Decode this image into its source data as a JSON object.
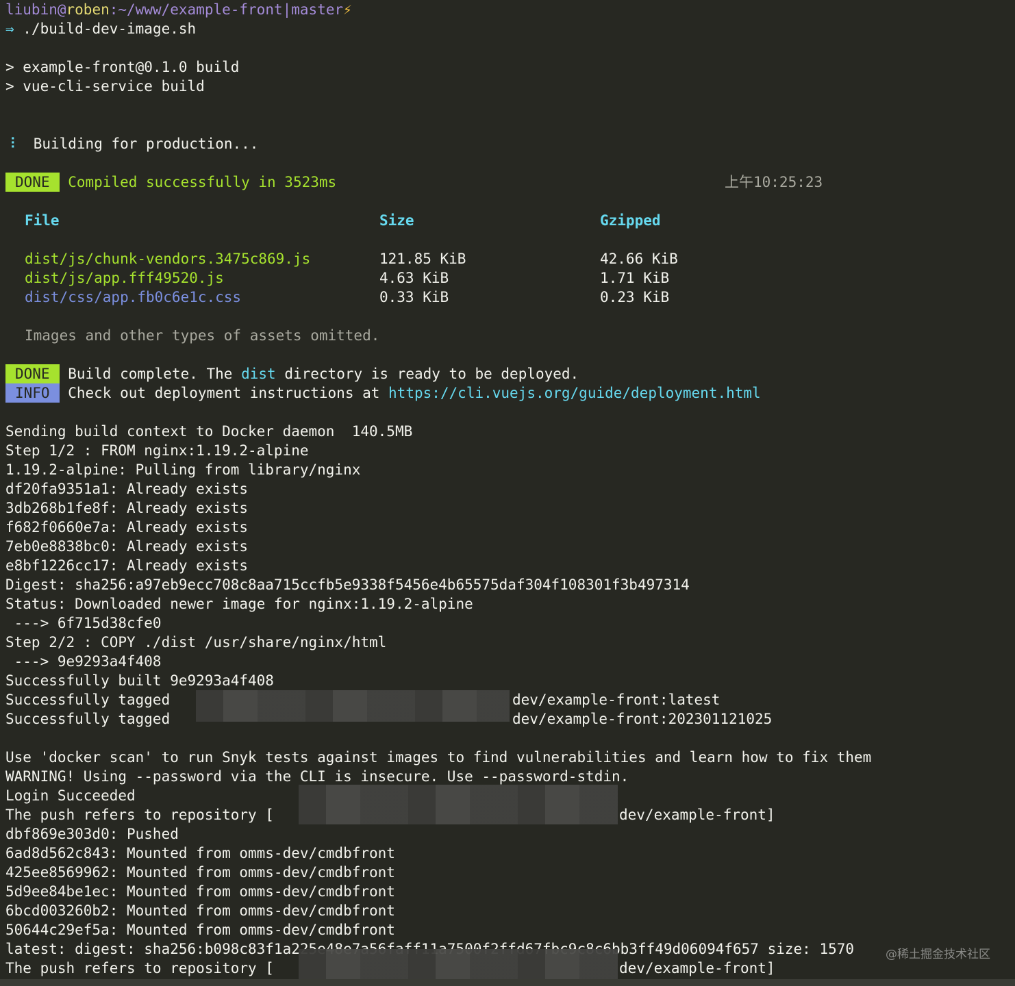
{
  "prompt": {
    "user": "liubin",
    "at": "@",
    "host": "roben",
    "colon": ":",
    "path": "~/www/example-front",
    "pipe": "|",
    "branch": "master",
    "bolt": "⚡",
    "arrow": "⇒",
    "command": " ./build-dev-image.sh"
  },
  "npm": {
    "line1": "> example-front@0.1.0 build",
    "line2": "> vue-cli-service build"
  },
  "building": {
    "spinner": "⠸",
    "text": "Building for production..."
  },
  "compiled": {
    "badge": "DONE",
    "text": "Compiled successfully in 3523ms",
    "time": "上午10:25:23"
  },
  "assets": {
    "headers": {
      "file": "File",
      "size": "Size",
      "gzipped": "Gzipped"
    },
    "rows": [
      {
        "file": "dist/js/chunk-vendors.3475c869.js",
        "size": "121.85 KiB",
        "gzipped": "42.66 KiB",
        "kind": "js"
      },
      {
        "file": "dist/js/app.fff49520.js",
        "size": "4.63 KiB",
        "gzipped": "1.71 KiB",
        "kind": "js"
      },
      {
        "file": "dist/css/app.fb0c6e1c.css",
        "size": "0.33 KiB",
        "gzipped": "0.23 KiB",
        "kind": "css"
      }
    ],
    "omitted": "Images and other types of assets omitted."
  },
  "build_done": {
    "badge": "DONE",
    "pre": "Build complete. The ",
    "dist": "dist",
    "post": " directory is ready to be deployed."
  },
  "build_info": {
    "badge": "INFO",
    "pre": "Check out deployment instructions at ",
    "url": "https://cli.vuejs.org/guide/deployment.html"
  },
  "docker_lines": [
    "Sending build context to Docker daemon  140.5MB",
    "Step 1/2 : FROM nginx:1.19.2-alpine",
    "1.19.2-alpine: Pulling from library/nginx",
    "df20fa9351a1: Already exists",
    "3db268b1fe8f: Already exists",
    "f682f0660e7a: Already exists",
    "7eb0e8838bc0: Already exists",
    "e8bf1226cc17: Already exists",
    "Digest: sha256:a97eb9ecc708c8aa715ccfb5e9338f5456e4b65575daf304f108301f3b497314",
    "Status: Downloaded newer image for nginx:1.19.2-alpine",
    " ---> 6f715d38cfe0",
    "Step 2/2 : COPY ./dist /usr/share/nginx/html",
    " ---> 9e9293a4f408",
    "Successfully built 9e9293a4f408"
  ],
  "tagged": {
    "prefix": "Successfully tagged ",
    "tag1": "dev/example-front:latest",
    "tag2": "dev/example-front:202301121025"
  },
  "push_lines": {
    "scan": "Use 'docker scan' to run Snyk tests against images to find vulnerabilities and learn how to fix them",
    "warning": "WARNING! Using --password via the CLI is insecure. Use --password-stdin.",
    "login": "Login Succeeded",
    "push_prefix": "The push refers to repository [",
    "push_suffix": "dev/example-front]",
    "layers": [
      "dbf869e303d0: Pushed",
      "6ad8d562c843: Mounted from omms-dev/cmdbfront",
      "425ee8569962: Mounted from omms-dev/cmdbfront",
      "5d9ee84be1ec: Mounted from omms-dev/cmdbfront",
      "6bcd003260b2: Mounted from omms-dev/cmdbfront",
      "50644c29ef5a: Mounted from omms-dev/cmdbfront"
    ],
    "digest": "latest: digest: sha256:b098c83f1a225e48e7a56faff11a7500f2ffd67fbc9c8c6bb3ff49d06094f657 size: 1570"
  },
  "watermark": "@稀土掘金技术社区"
}
